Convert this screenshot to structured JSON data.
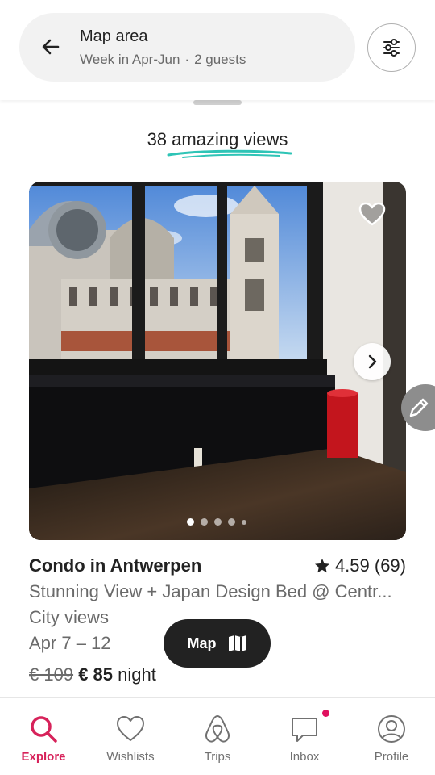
{
  "header": {
    "title": "Map area",
    "subtitle_dates": "Week in Apr-Jun",
    "subtitle_separator": "·",
    "subtitle_guests": "2 guests"
  },
  "results": {
    "title": "38 amazing views"
  },
  "listing": {
    "title": "Condo in Antwerpen",
    "rating": "4.59 (69)",
    "description": "Stunning View + Japan Design Bed @ Centr...",
    "feature": "City views",
    "dates": "Apr 7 – 12",
    "price_old": "€ 109",
    "price_new": "€ 85",
    "price_unit": "night",
    "photo_count": 5,
    "photo_active_index": 1
  },
  "map_button": {
    "label": "Map"
  },
  "nav": {
    "items": [
      {
        "label": "Explore",
        "icon": "search-icon",
        "active": true
      },
      {
        "label": "Wishlists",
        "icon": "heart-icon",
        "active": false
      },
      {
        "label": "Trips",
        "icon": "airbnb-logo-icon",
        "active": false
      },
      {
        "label": "Inbox",
        "icon": "message-icon",
        "active": false,
        "badge": true
      },
      {
        "label": "Profile",
        "icon": "user-circle-icon",
        "active": false
      }
    ]
  },
  "colors": {
    "accent": "#d7225a",
    "underline": "#2ec4b6",
    "dark": "#222222"
  }
}
